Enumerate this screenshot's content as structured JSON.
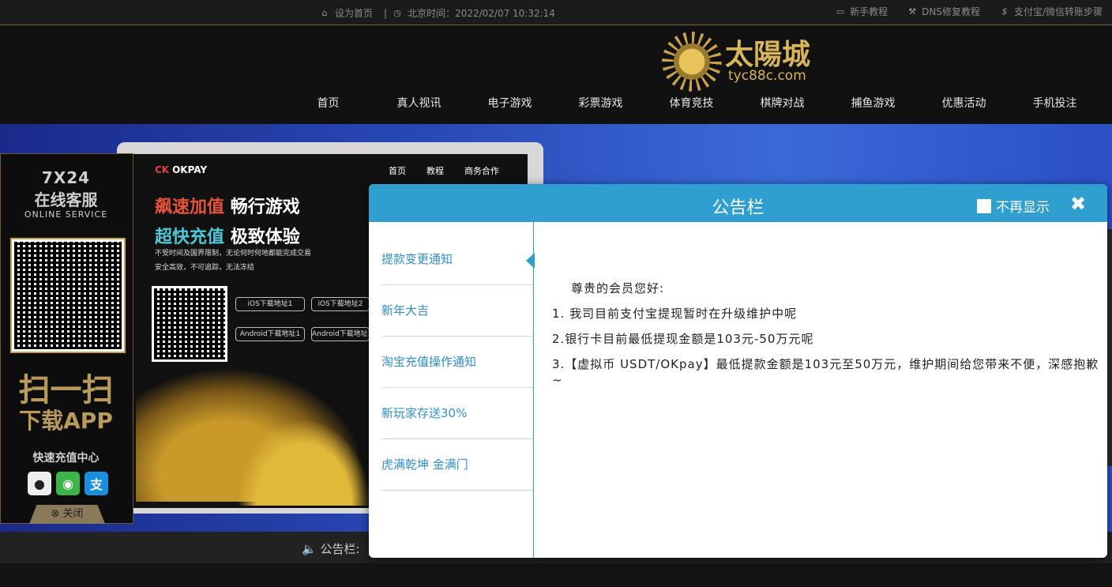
{
  "topbar": {
    "set_home": "设为首页",
    "separator": "|",
    "beijing_time": "北京时间：2022/02/07 10:32:14",
    "links": [
      "新手教程",
      "DNS修复教程",
      "支付宝/微信转账步骤"
    ]
  },
  "logo": {
    "name": "太陽城",
    "url": "tyc88c.com"
  },
  "nav": [
    "首页",
    "真人视讯",
    "电子游戏",
    "彩票游戏",
    "体育竞技",
    "棋牌对战",
    "捕鱼游戏",
    "优惠活动",
    "手机投注"
  ],
  "banner": {
    "brand_mark": "CK",
    "brand": "OKPAY",
    "nav": [
      "首页",
      "教程",
      "商务合作"
    ],
    "headline1_a": "飙速加值",
    "headline1_b": "畅行游戏",
    "headline2_a": "超快充值",
    "headline2_b": "极致体验",
    "sub1": "不受时间及国界限制，无论何时何地都能完成交易",
    "sub2": "安全高效，不可追踪，无法冻结",
    "buttons": [
      "iOS下载地址1",
      "iOS下载地址2",
      "Android下载地址1",
      "Android下载地址2"
    ]
  },
  "side_panel": {
    "title_line1": "7X24",
    "title_line2": "在线客服",
    "title_en": "ONLINE SERVICE",
    "scan": "扫一扫",
    "download": "下载APP",
    "fast_charge": "快速充值中心",
    "pay_icons": [
      "qq-icon",
      "wechat-icon",
      "alipay-icon"
    ],
    "alipay_glyph": "支",
    "close": "关闭"
  },
  "notice_bar": {
    "label": "公告栏:"
  },
  "modal": {
    "title": "公告栏",
    "no_show": "不再显示",
    "close_glyph": "✖",
    "items": [
      "提款变更通知",
      "新年大吉",
      "淘宝充值操作通知",
      "新玩家存送30%",
      "虎满乾坤 金满门"
    ],
    "active_index": 0,
    "content": {
      "greeting": "尊贵的会员您好:",
      "lines": [
        "1. 我司目前支付宝提现暂时在升级维护中呢",
        "2.银行卡目前最低提现金额是103元-50万元呢",
        "3.【虚拟币 USDT/OKpay】最低提款金额是103元至50万元，维护期间给您带来不便，深感抱歉~"
      ]
    }
  },
  "colors": {
    "modal_header": "#2f9fd0",
    "gold": "#d7b55b",
    "link_blue": "#2f8fc8"
  }
}
